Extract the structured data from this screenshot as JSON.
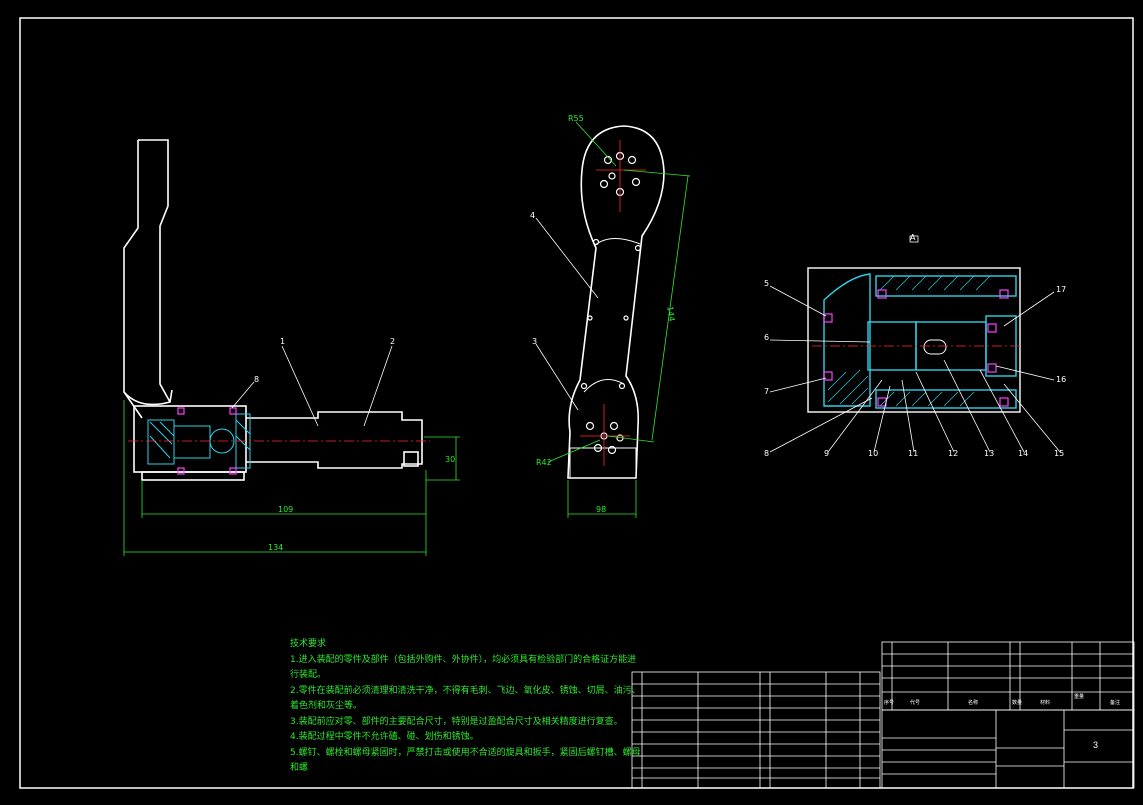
{
  "colors": {
    "background": "#000000",
    "outline": "#ffffff",
    "dimension": "#2ee82e",
    "centerline": "#ff2a2a",
    "hatch": "#2fd0e8",
    "fastener": "#ff40ff",
    "callout": "#ffffff"
  },
  "drawing": {
    "side_view": {
      "dims": {
        "overall": "134",
        "length": "109",
        "height": "30"
      },
      "callouts": [
        "1",
        "2",
        "8"
      ]
    },
    "front_view": {
      "dims": {
        "top_radius": "R55",
        "bottom_radius": "R42",
        "height": "144",
        "width": "98"
      },
      "callouts": [
        "4",
        "3"
      ]
    },
    "section_view": {
      "section_mark": "A",
      "callouts_left": [
        "5",
        "6",
        "7"
      ],
      "callouts_right": [
        "17",
        "16"
      ],
      "callouts_bottom": [
        "8",
        "9",
        "10",
        "11",
        "12",
        "13",
        "14",
        "15"
      ]
    }
  },
  "technical_notes": {
    "title": "技术要求",
    "lines": [
      "1.进入装配的零件及部件（包括外购件、外协件），均必须具有检验部门的合格证方能进",
      "行装配。",
      "2.零件在装配前必须清理和清洗干净，不得有毛刺、飞边、氧化皮、锈蚀、切屑、油污、",
      "着色剂和灰尘等。",
      "3.装配前应对零、部件的主要配合尺寸，特别是过盈配合尺寸及相关精度进行复查。",
      "4.装配过程中零件不允许磕、碰、划伤和锈蚀。",
      "5.螺钉、螺栓和螺母紧固时，严禁打击或使用不合适的旋具和扳手，紧固后螺钉槽、螺母",
      "和螺"
    ]
  },
  "title_block": {
    "header": {
      "seq": "序号",
      "code": "代号",
      "name": "名称",
      "qty": "数量",
      "material": "材料",
      "weight": "重量",
      "remark": "备注"
    },
    "sheet_number": "3"
  }
}
